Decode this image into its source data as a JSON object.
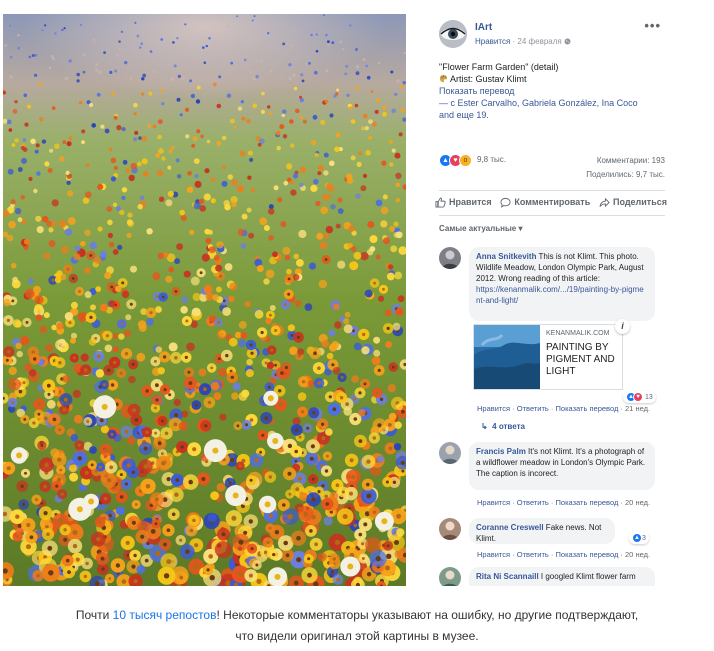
{
  "post": {
    "page_name": "IArt",
    "like_label": "Нравится",
    "dot": " · ",
    "date": "24 февраля",
    "more_glyph": "•••",
    "title": "\"Flower Farm Garden\" (detail)",
    "artist": "Artist: Gustav Klimt",
    "translate": "Показать перевод",
    "with_prefix": "— с ",
    "tagged": "Ester Carvalho, Gabriela González, Ina Coco",
    "and_word": "and ",
    "more_tagged": "еще 19.",
    "reactions_count": "9,8 тыс.",
    "comments_count": "Комментарии: 193",
    "shares_count": "Поделились: 9,7 тыс."
  },
  "actions": {
    "like": "Нравится",
    "comment": "Комментировать",
    "share": "Поделиться"
  },
  "sort_label": "Самые актуальные ▾",
  "comments": [
    {
      "author": "Anna Snitkevith",
      "text": " This is not Klimt. This photo. Wildlife Meadow, London Olympic Park, August 2012. Wrong reading of this article:",
      "link": "https://kenanmalik.com/.../19/painting-by-pigment-and-light/",
      "preview_domain": "KENANMALIK.COM",
      "preview_title": "PAINTING BY PIGMENT AND LIGHT",
      "reaction_count": "13",
      "like": "Нравится",
      "reply": "Ответить",
      "translate": "Показать перевод",
      "age": "21 нед.",
      "replies": "4 ответа"
    },
    {
      "author": "Francis Palm",
      "text": " It's not Klimt. It's a photograph of a wildflower meadow in London's Olympic Park. The caption is incorect.",
      "like": "Нравится",
      "reply": "Ответить",
      "translate": "Показать перевод",
      "age": "20 нед."
    },
    {
      "author": "Coranne Creswell",
      "text": " Fake news. Not Klimt.",
      "reaction_count": "3",
      "like": "Нравится",
      "reply": "Ответить",
      "translate": "Показать перевод",
      "age": "20 нед."
    },
    {
      "author": "Rita Ni Scannaill",
      "text": " I googled Klimt flower farm"
    }
  ],
  "caption": {
    "before": "Почти ",
    "link": "10 тысяч репостов",
    "after": "! Некоторые комментаторы указывают на ошибку, но другие подтверждают,",
    "line2": "что видели оригинал этой картины в музее."
  },
  "colors": {
    "link": "#385898",
    "caption_link": "#1a73e8",
    "muted": "#606770"
  }
}
